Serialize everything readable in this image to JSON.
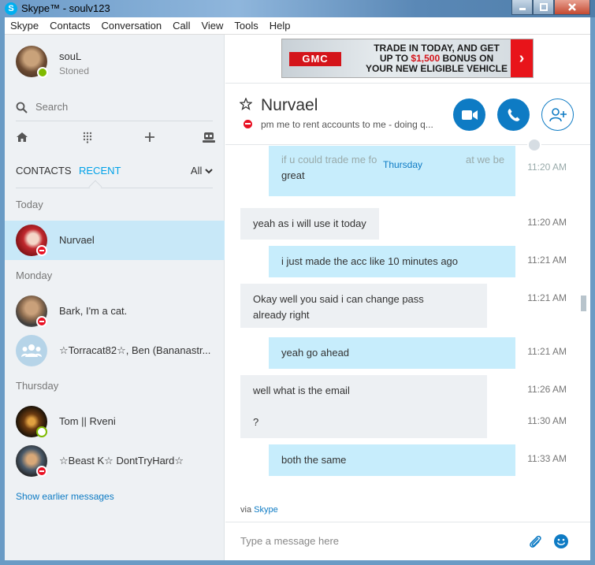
{
  "window": {
    "title": "Skype™ - soulv123"
  },
  "menu": [
    "Skype",
    "Contacts",
    "Conversation",
    "Call",
    "View",
    "Tools",
    "Help"
  ],
  "profile": {
    "name": "souL",
    "mood": "Stoned"
  },
  "search": {
    "placeholder": "Search"
  },
  "tabs": {
    "contacts": "CONTACTS",
    "recent": "RECENT",
    "filter": "All"
  },
  "sections": {
    "today": "Today",
    "monday": "Monday",
    "thursday": "Thursday"
  },
  "contacts": [
    {
      "name": "Nurvael",
      "status": "dnd"
    },
    {
      "name": "Bark, I'm a cat.",
      "status": "dnd"
    },
    {
      "name": "☆Torracat82☆, Ben (Bananastr...",
      "status": "group"
    },
    {
      "name": "Tom || Rveni",
      "status": "away"
    },
    {
      "name": "☆Beast K☆ DontTryHard☆",
      "status": "dnd"
    }
  ],
  "show_earlier": "Show earlier messages",
  "ad": {
    "brand": "GMC",
    "line1": "TRADE IN TODAY, AND GET",
    "line2_pre": "UP TO ",
    "line2_amount": "$1,500",
    "line2_post": " BONUS ON",
    "line3": "YOUR NEW ELIGIBLE VEHICLE"
  },
  "chat": {
    "name": "Nurvael",
    "mood": "pm me to rent accounts to me - doing q...",
    "day_divider": "Thursday",
    "partial": {
      "line1": "if u could trade me fo",
      "line1b": "at we be",
      "line2": "great",
      "time": "11:20 AM"
    },
    "messages": [
      {
        "text": "yeah as i will use it today",
        "time": "11:20 AM",
        "dir": "in"
      },
      {
        "text": "i just made the acc like 10 minutes ago",
        "time": "11:21 AM",
        "dir": "out"
      },
      {
        "text": "Okay well you said i can change pass",
        "text2": "already right",
        "time": "11:21 AM",
        "dir": "in"
      },
      {
        "text": "yeah go ahead",
        "time": "11:21 AM",
        "dir": "out"
      },
      {
        "text": "well what is the email",
        "time": "11:26 AM",
        "dir": "in"
      },
      {
        "text": "?",
        "time": "11:30 AM",
        "dir": "in"
      },
      {
        "text": "both the same",
        "time": "11:33 AM",
        "dir": "out"
      }
    ],
    "via_prefix": "via ",
    "via_link": "Skype",
    "composer_placeholder": "Type a message here"
  },
  "colors": {
    "accent": "#0e7bc4",
    "selected": "#c8e8f8",
    "outgoing": "#c7edfc",
    "incoming": "#edf0f3",
    "dnd": "#e81123",
    "online": "#7fba00"
  }
}
